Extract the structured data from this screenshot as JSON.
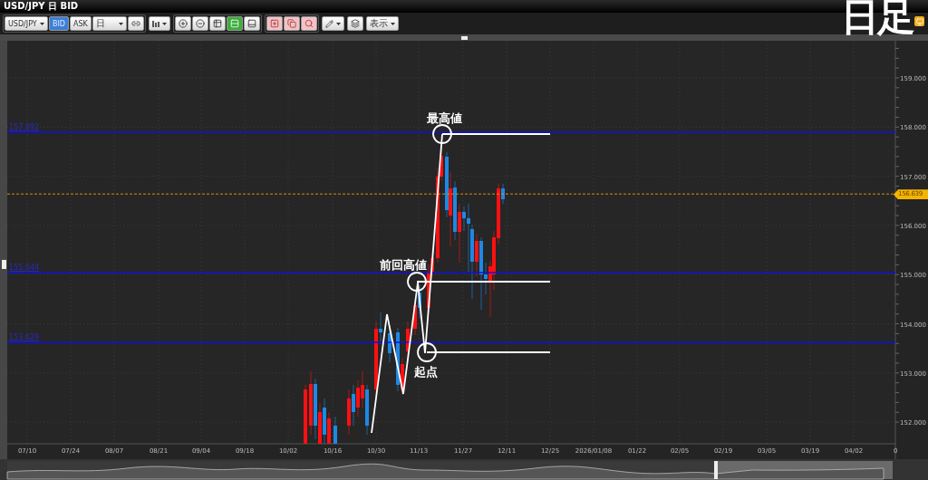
{
  "window": {
    "title": "USD/JPY 日 BID"
  },
  "caption": "日足",
  "toolbar": {
    "symbol": "USD/JPY",
    "price_sides": [
      {
        "label": "BID",
        "selected": true
      },
      {
        "label": "ASK",
        "selected": false
      }
    ],
    "period": "日",
    "layout_buttons": [
      {
        "selected": false
      },
      {
        "selected": true
      },
      {
        "selected": false
      }
    ],
    "display_button": "表示"
  },
  "chart": {
    "yticks": [
      "159.000",
      "158.000",
      "157.000",
      "156.000",
      "155.000",
      "154.000",
      "153.000",
      "152.000"
    ],
    "xticks": [
      "07/10",
      "07/24",
      "08/07",
      "08/21",
      "09/04",
      "09/18",
      "10/02",
      "10/16",
      "10/30",
      "11/13",
      "11/27",
      "12/11",
      "12/25",
      "2026/01/08",
      "01/22",
      "02/05",
      "02/19",
      "03/05",
      "03/19",
      "04/02",
      "0"
    ],
    "levels": [
      {
        "label": "157.892"
      },
      {
        "label": "155.044"
      },
      {
        "label": "153.629"
      }
    ],
    "current_price": "156.639",
    "annotations": [
      {
        "label": "最高値"
      },
      {
        "label": "前回高値"
      },
      {
        "label": "起点"
      }
    ]
  }
}
